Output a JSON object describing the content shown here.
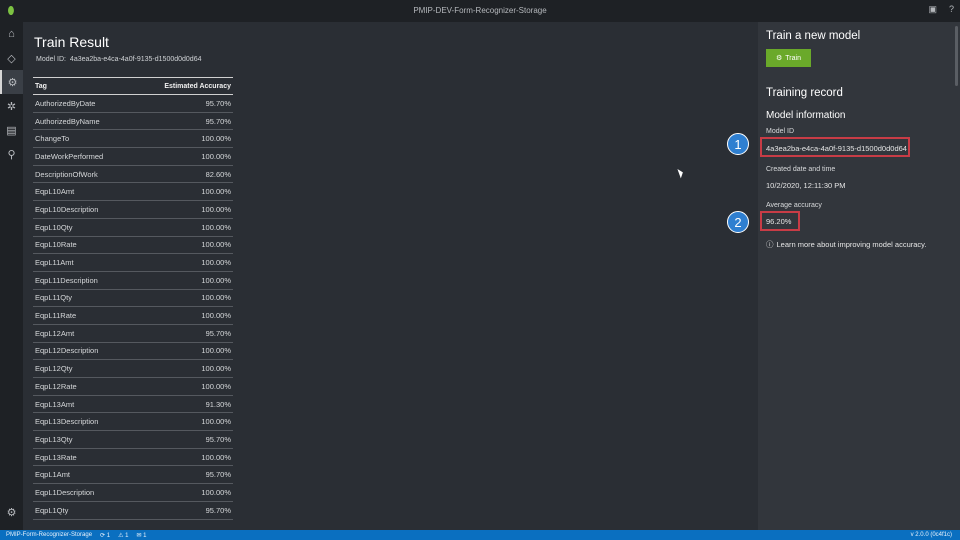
{
  "window": {
    "title": "PMIP-DEV-Form-Recognizer-Storage",
    "logo_icon": "leaf-icon"
  },
  "nav": {
    "items": [
      {
        "icon": "home-icon",
        "glyph": "⌂"
      },
      {
        "icon": "tag-icon",
        "glyph": "◇"
      },
      {
        "icon": "train-icon",
        "glyph": "⚙"
      },
      {
        "icon": "model-icon",
        "glyph": "✲"
      },
      {
        "icon": "document-icon",
        "glyph": "▤"
      },
      {
        "icon": "connection-icon",
        "glyph": "⚲"
      }
    ],
    "settings_glyph": "⚙"
  },
  "train_result": {
    "title": "Train Result",
    "model_id_label": "Model ID:",
    "model_id_value": "4a3ea2ba-e4ca-4a0f-9135-d1500d0d0d64",
    "columns": {
      "tag": "Tag",
      "accuracy": "Estimated Accuracy"
    },
    "rows": [
      {
        "tag": "AuthorizedByDate",
        "accuracy": "95.70%"
      },
      {
        "tag": "AuthorizedByName",
        "accuracy": "95.70%"
      },
      {
        "tag": "ChangeTo",
        "accuracy": "100.00%"
      },
      {
        "tag": "DateWorkPerformed",
        "accuracy": "100.00%"
      },
      {
        "tag": "DescriptionOfWork",
        "accuracy": "82.60%"
      },
      {
        "tag": "EqpL10Amt",
        "accuracy": "100.00%"
      },
      {
        "tag": "EqpL10Description",
        "accuracy": "100.00%"
      },
      {
        "tag": "EqpL10Qty",
        "accuracy": "100.00%"
      },
      {
        "tag": "EqpL10Rate",
        "accuracy": "100.00%"
      },
      {
        "tag": "EqpL11Amt",
        "accuracy": "100.00%"
      },
      {
        "tag": "EqpL11Description",
        "accuracy": "100.00%"
      },
      {
        "tag": "EqpL11Qty",
        "accuracy": "100.00%"
      },
      {
        "tag": "EqpL11Rate",
        "accuracy": "100.00%"
      },
      {
        "tag": "EqpL12Amt",
        "accuracy": "95.70%"
      },
      {
        "tag": "EqpL12Description",
        "accuracy": "100.00%"
      },
      {
        "tag": "EqpL12Qty",
        "accuracy": "100.00%"
      },
      {
        "tag": "EqpL12Rate",
        "accuracy": "100.00%"
      },
      {
        "tag": "EqpL13Amt",
        "accuracy": "91.30%"
      },
      {
        "tag": "EqpL13Description",
        "accuracy": "100.00%"
      },
      {
        "tag": "EqpL13Qty",
        "accuracy": "95.70%"
      },
      {
        "tag": "EqpL13Rate",
        "accuracy": "100.00%"
      },
      {
        "tag": "EqpL1Amt",
        "accuracy": "95.70%"
      },
      {
        "tag": "EqpL1Description",
        "accuracy": "100.00%"
      },
      {
        "tag": "EqpL1Qty",
        "accuracy": "95.70%"
      }
    ]
  },
  "side_panel": {
    "new_model_title": "Train a new model",
    "train_button_label": "Train",
    "training_record_title": "Training record",
    "model_info_title": "Model information",
    "model_id_label": "Model ID",
    "model_id_value": "4a3ea2ba-e4ca-4a0f-9135-d1500d0d0d64",
    "created_label": "Created date and time",
    "created_value": "10/2/2020, 12:11:30 PM",
    "avg_accuracy_label": "Average accuracy",
    "avg_accuracy_value": "96.20%",
    "learn_more": "Learn more about improving model accuracy."
  },
  "callouts": [
    "1",
    "2"
  ],
  "statusbar": {
    "left": "PMIP-Form-Recognizer-Storage",
    "items": [
      "⟳ 1",
      "⚠ 1",
      "✉ 1"
    ],
    "right": "v 2.0.0 (0c4f1c)"
  },
  "colors": {
    "accent_green": "#6aa92a",
    "highlight_red": "#c83c46",
    "callout_blue": "#2f7fd0",
    "statusbar_blue": "#0a6fc0"
  }
}
